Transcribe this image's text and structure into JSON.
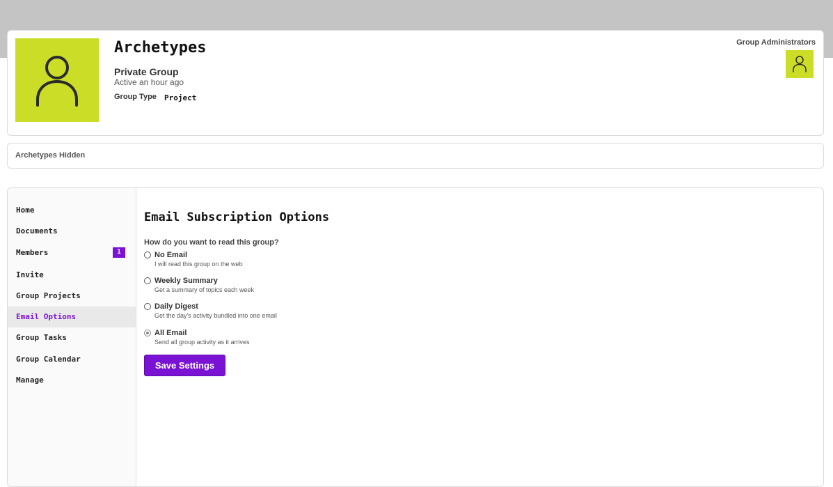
{
  "group": {
    "name": "Archetypes",
    "privacy": "Private Group",
    "activity": "Active an hour ago",
    "type_label": "Group Type",
    "type_value": "Project"
  },
  "admins": {
    "title": "Group Administrators"
  },
  "hidden_bar": {
    "text": "Archetypes Hidden"
  },
  "nav": {
    "items": [
      {
        "label": "Home"
      },
      {
        "label": "Documents"
      },
      {
        "label": "Members",
        "badge": "1"
      },
      {
        "label": "Invite"
      },
      {
        "label": "Group Projects"
      },
      {
        "label": "Email Options",
        "active": true
      },
      {
        "label": "Group Tasks"
      },
      {
        "label": "Group Calendar"
      },
      {
        "label": "Manage"
      }
    ]
  },
  "email": {
    "title": "Email Subscription Options",
    "question": "How do you want to read this group?",
    "selected": "All Email",
    "options": [
      {
        "label": "No Email",
        "desc": "I will read this group on the web"
      },
      {
        "label": "Weekly Summary",
        "desc": "Get a summary of topics each week"
      },
      {
        "label": "Daily Digest",
        "desc": "Get the day's activity bundled into one email"
      },
      {
        "label": "All Email",
        "desc": "Send all group activity as it arrives"
      }
    ],
    "save_label": "Save Settings"
  },
  "colors": {
    "accent": "#7a12d4",
    "avatar_bg": "#cbdd27",
    "top_band": "#c4c4c4"
  },
  "icons": {
    "group_avatar": "user-icon",
    "admin_avatar": "user-icon"
  }
}
